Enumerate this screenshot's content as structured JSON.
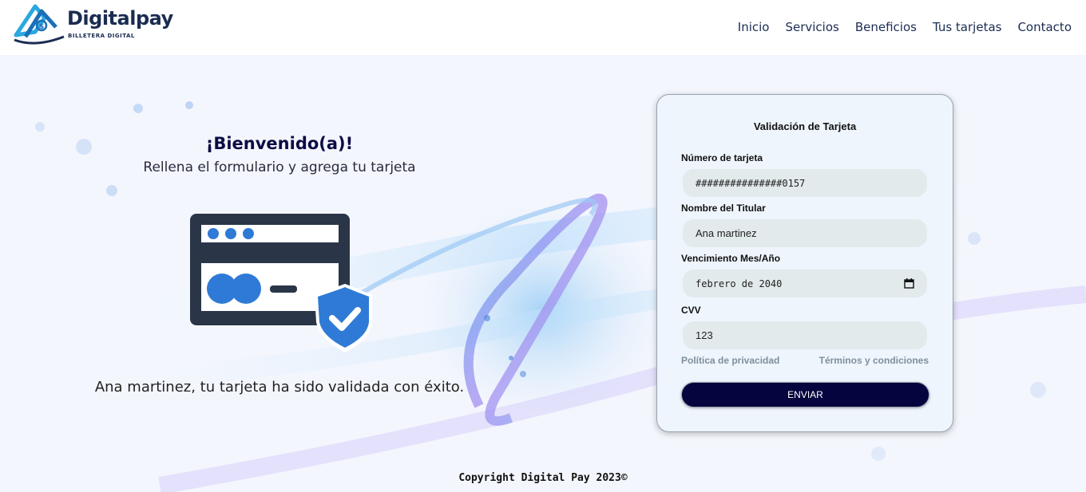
{
  "brand": {
    "name": "Digitalpay",
    "tagline": "BILLETERA DIGITAL",
    "colors": {
      "navy": "#1b2c52",
      "blue": "#2f7ad6",
      "dark": "#04043e"
    }
  },
  "nav": {
    "items": [
      {
        "label": "Inicio"
      },
      {
        "label": "Servicios"
      },
      {
        "label": "Beneficios"
      },
      {
        "label": "Tus tarjetas"
      },
      {
        "label": "Contacto"
      }
    ]
  },
  "welcome": {
    "title": "¡Bienvenido(a)!",
    "subtitle": "Rellena el formulario y agrega tu tarjeta",
    "success_message": "Ana martinez, tu tarjeta ha sido validada con éxito.",
    "illustration": "credit-card-shield-check-icon"
  },
  "form": {
    "title": "Validación de Tarjeta",
    "card_number": {
      "label": "Número de tarjeta",
      "value": "###############0157"
    },
    "holder": {
      "label": "Nombre del Titular",
      "value": "Ana martinez"
    },
    "expiry": {
      "label": "Vencimiento Mes/Año",
      "value": "febrero de 2040",
      "icon": "calendar-icon"
    },
    "cvv": {
      "label": "CVV",
      "value": "123"
    },
    "privacy_link": "Política de privacidad",
    "terms_link": "Términos y condiciones",
    "submit_label": "ENVIAR"
  },
  "footer": {
    "copyright": "Copyright Digital Pay 2023©"
  }
}
